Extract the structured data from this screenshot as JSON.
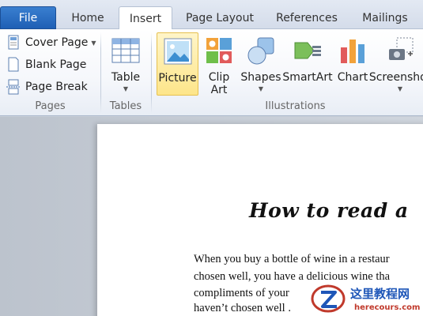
{
  "tabs": {
    "file": "File",
    "home": "Home",
    "insert": "Insert",
    "page_layout": "Page Layout",
    "references": "References",
    "mailings": "Mailings"
  },
  "groups": {
    "pages": {
      "label": "Pages",
      "items": {
        "cover_page": "Cover Page",
        "blank_page": "Blank Page",
        "page_break": "Page Break"
      }
    },
    "tables": {
      "label": "Tables",
      "table": "Table"
    },
    "illustrations": {
      "label": "Illustrations",
      "picture": "Picture",
      "clip_line1": "Clip",
      "clip_line2": "Art",
      "shapes": "Shapes",
      "smartart": "SmartArt",
      "chart": "Chart",
      "screenshot": "Screenshot"
    }
  },
  "document": {
    "title": "How to read a",
    "lines": [
      "When you buy a bottle of wine in a restaur",
      "chosen well, you have a delicious wine tha",
      "compliments of your",
      "haven’t chosen well ."
    ]
  },
  "watermark": {
    "text": "这里教程网",
    "url": "herecours.com"
  },
  "colors": {
    "file_tab": "#2a6cc4",
    "highlight": "#fde58a",
    "ribbon_bg": "#f5f7fb"
  }
}
